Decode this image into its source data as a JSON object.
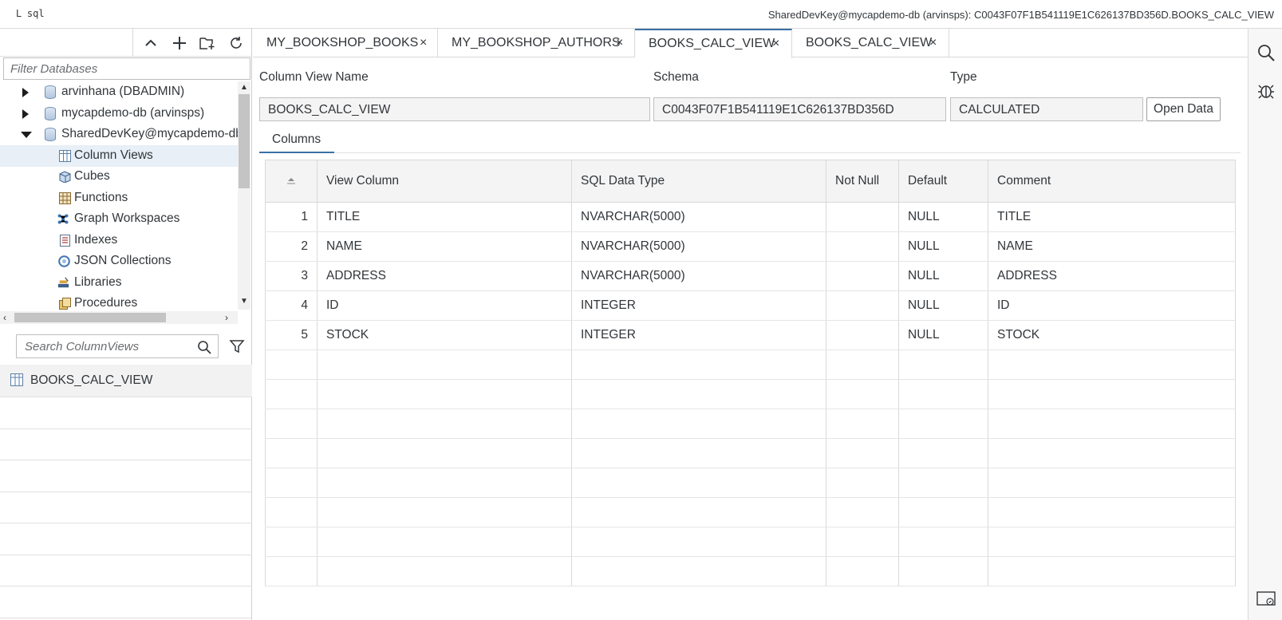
{
  "topbar": {
    "app_icon_label": "ᒪ sql",
    "connection_title": "SharedDevKey@mycapdemo-db (arvinsps): C0043F07F1B541119E1C626137BD356D.BOOKS_CALC_VIEW"
  },
  "left_panel": {
    "filter_placeholder": "Filter Databases",
    "tree": [
      {
        "label": "arvinhana (DBADMIN)",
        "level": 0,
        "expanded": false,
        "icon": "database-icon"
      },
      {
        "label": "mycapdemo-db (arvinsps)",
        "level": 0,
        "expanded": false,
        "icon": "database-icon"
      },
      {
        "label": "SharedDevKey@mycapdemo-db",
        "level": 0,
        "expanded": true,
        "icon": "database-icon"
      },
      {
        "label": "Column Views",
        "level": 1,
        "selected": true,
        "icon": "column-view-icon"
      },
      {
        "label": "Cubes",
        "level": 1,
        "icon": "cube-icon"
      },
      {
        "label": "Functions",
        "level": 1,
        "icon": "function-icon"
      },
      {
        "label": "Graph Workspaces",
        "level": 1,
        "icon": "graph-icon"
      },
      {
        "label": "Indexes",
        "level": 1,
        "icon": "index-icon"
      },
      {
        "label": "JSON Collections",
        "level": 1,
        "icon": "json-icon"
      },
      {
        "label": "Libraries",
        "level": 1,
        "icon": "library-icon"
      },
      {
        "label": "Procedures",
        "level": 1,
        "icon": "procedure-icon"
      }
    ],
    "search_placeholder": "Search ColumnViews",
    "results": [
      "BOOKS_CALC_VIEW"
    ]
  },
  "tabs": [
    {
      "label": "MY_BOOKSHOP_BOOKS",
      "active": false
    },
    {
      "label": "MY_BOOKSHOP_AUTHORS",
      "active": false
    },
    {
      "label": "BOOKS_CALC_VIEW",
      "active": true
    },
    {
      "label": "BOOKS_CALC_VIEW",
      "active": false
    }
  ],
  "details": {
    "name_label": "Column View Name",
    "name_value": "BOOKS_CALC_VIEW",
    "schema_label": "Schema",
    "schema_value": "C0043F07F1B541119E1C626137BD356D",
    "type_label": "Type",
    "type_value": "CALCULATED",
    "open_data_label": "Open Data"
  },
  "subtab": {
    "label": "Columns"
  },
  "columns_table": {
    "headers": [
      "View Column",
      "SQL Data Type",
      "Not Null",
      "Default",
      "Comment"
    ],
    "rows": [
      {
        "num": "1",
        "column": "TITLE",
        "type": "NVARCHAR(5000)",
        "not_null": "",
        "default": "NULL",
        "comment": "TITLE"
      },
      {
        "num": "2",
        "column": "NAME",
        "type": "NVARCHAR(5000)",
        "not_null": "",
        "default": "NULL",
        "comment": "NAME"
      },
      {
        "num": "3",
        "column": "ADDRESS",
        "type": "NVARCHAR(5000)",
        "not_null": "",
        "default": "NULL",
        "comment": "ADDRESS"
      },
      {
        "num": "4",
        "column": "ID",
        "type": "INTEGER",
        "not_null": "",
        "default": "NULL",
        "comment": "ID"
      },
      {
        "num": "5",
        "column": "STOCK",
        "type": "INTEGER",
        "not_null": "",
        "default": "NULL",
        "comment": "STOCK"
      }
    ],
    "empty_rows": 8
  },
  "colors": {
    "accent": "#3a70a5",
    "selection": "#e8eff6",
    "header_bg": "#f4f4f4"
  }
}
